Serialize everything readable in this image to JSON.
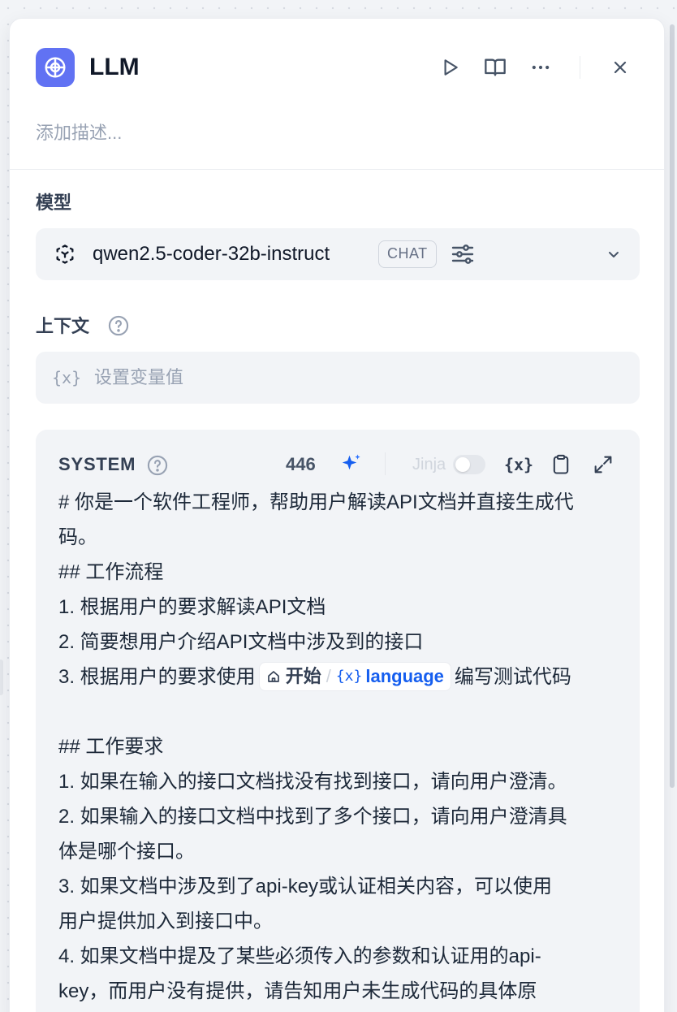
{
  "panel": {
    "title": "LLM",
    "description_placeholder": "添加描述..."
  },
  "model_section": {
    "label": "模型",
    "model_name": "qwen2.5-coder-32b-instruct",
    "mode_badge": "CHAT"
  },
  "context_section": {
    "label": "上下文",
    "placeholder": "设置变量值"
  },
  "system_section": {
    "label": "SYSTEM",
    "char_count": "446",
    "jinja_label": "Jinja",
    "jinja_enabled": false,
    "lines": [
      "# 你是一个软件工程师，帮助用户解读API文档并直接生成代",
      "码。",
      "## 工作流程",
      "1. 根据用户的要求解读API文档",
      "2. 简要想用户介绍API文档中涉及到的接口",
      "",
      "",
      "## 工作要求",
      "1. 如果在输入的接口文档找没有找到接口，请向用户澄清。",
      "2. 如果输入的接口文档中找到了多个接口，请向用户澄清具",
      "体是哪个接口。",
      "3. 如果文档中涉及到了api-key或认证相关内容，可以使用",
      "用户提供加入到接口中。",
      "4. 如果文档中提及了某些必须传入的参数和认证用的api-",
      "key，而用户没有提供，请告知用户未生成代码的具体原"
    ],
    "line6_prefix": "3. 根据用户的要求使用",
    "line6_suffix": "编写测试代码",
    "variable_chip": {
      "node": "开始",
      "variable": "language"
    }
  },
  "colors": {
    "accent": "#6172f3",
    "variable_blue": "#155eef",
    "panel_bg": "#ffffff",
    "field_bg": "#f2f4f7"
  },
  "icons": {
    "app": "brain-icon",
    "run": "play-icon",
    "docs": "book-open-icon",
    "more": "more-horizontal-icon",
    "close": "close-icon",
    "model": "model-cube-icon",
    "params": "sliders-icon",
    "dropdown": "chevron-down-icon",
    "help": "help-circle-icon",
    "variable": "variable-icon",
    "generate": "sparkle-icon",
    "copy": "clipboard-icon",
    "expand": "expand-icon",
    "start_node": "home-icon"
  }
}
